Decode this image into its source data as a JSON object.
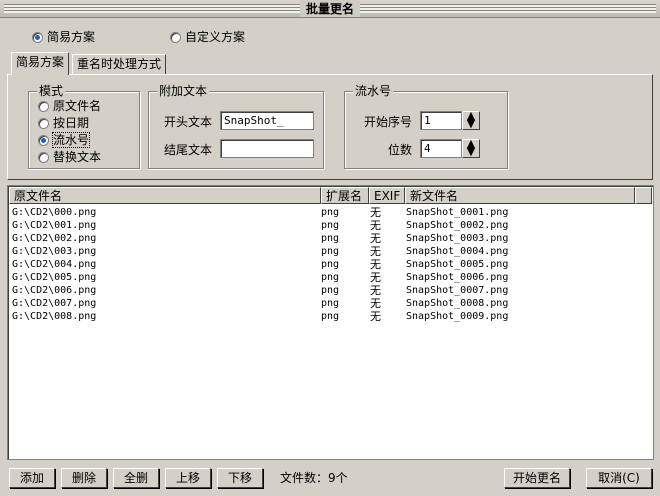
{
  "window": {
    "title": "批量更名"
  },
  "mode_radios": [
    {
      "label": "简易方案",
      "selected": true
    },
    {
      "label": "自定义方案",
      "selected": false
    }
  ],
  "tabs": [
    {
      "label": "简易方案",
      "active": true
    },
    {
      "label": "重名时处理方式",
      "active": false
    }
  ],
  "pattern_group": {
    "title": "模式",
    "options": [
      {
        "label": "原文件名",
        "selected": false
      },
      {
        "label": "按日期",
        "selected": false
      },
      {
        "label": "流水号",
        "selected": true
      },
      {
        "label": "替换文本",
        "selected": false
      }
    ]
  },
  "append_text_group": {
    "title": "附加文本",
    "prefix_label": "开头文本",
    "prefix_value": "SnapShot_",
    "suffix_label": "结尾文本",
    "suffix_value": ""
  },
  "serial_group": {
    "title": "流水号",
    "start_label": "开始序号",
    "start_value": "1",
    "digits_label": "位数",
    "digits_value": "4"
  },
  "file_list": {
    "columns": [
      "原文件名",
      "扩展名",
      "EXIF",
      "新文件名"
    ],
    "rows": [
      [
        "G:\\CD2\\000.png",
        "png",
        "无",
        "SnapShot_0001.png"
      ],
      [
        "G:\\CD2\\001.png",
        "png",
        "无",
        "SnapShot_0002.png"
      ],
      [
        "G:\\CD2\\002.png",
        "png",
        "无",
        "SnapShot_0003.png"
      ],
      [
        "G:\\CD2\\003.png",
        "png",
        "无",
        "SnapShot_0004.png"
      ],
      [
        "G:\\CD2\\004.png",
        "png",
        "无",
        "SnapShot_0005.png"
      ],
      [
        "G:\\CD2\\005.png",
        "png",
        "无",
        "SnapShot_0006.png"
      ],
      [
        "G:\\CD2\\006.png",
        "png",
        "无",
        "SnapShot_0007.png"
      ],
      [
        "G:\\CD2\\007.png",
        "png",
        "无",
        "SnapShot_0008.png"
      ],
      [
        "G:\\CD2\\008.png",
        "png",
        "无",
        "SnapShot_0009.png"
      ]
    ]
  },
  "bottom_bar": {
    "add_label": "添加",
    "delete_label": "删除",
    "clear_label": "全删",
    "up_label": "上移",
    "down_label": "下移",
    "file_count_label": "文件数：9个",
    "start_rename_label": "开始更名",
    "cancel_label": "取消(C)"
  },
  "colors": {
    "face": "#d4d0c8",
    "radio_selected": "#1a5fd0"
  }
}
